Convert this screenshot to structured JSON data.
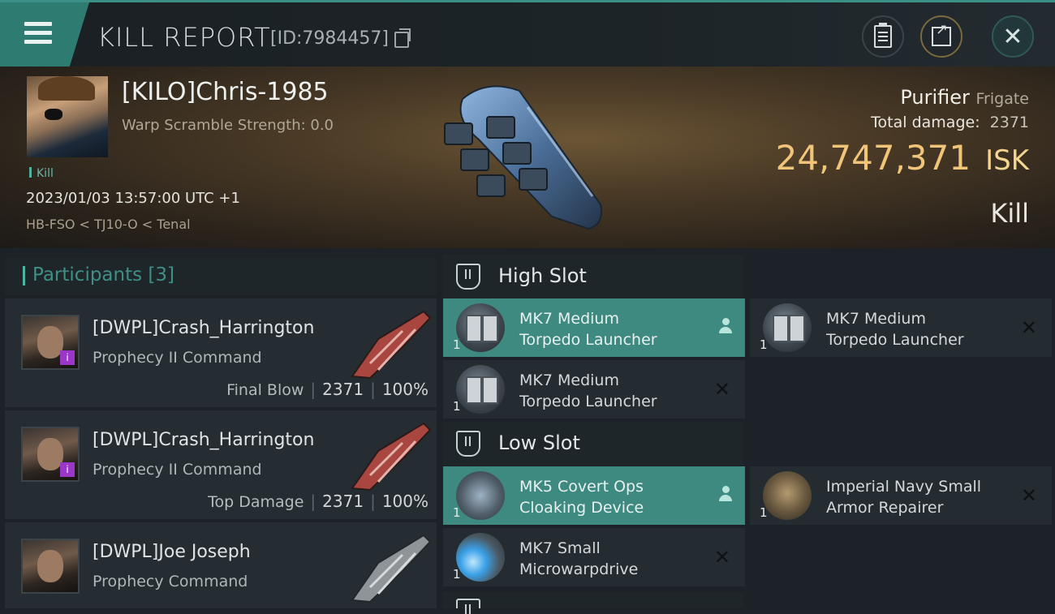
{
  "header": {
    "title": "KILL REPORT",
    "report_id": "[ID:7984457]",
    "icons": [
      "menu-icon",
      "copy-icon",
      "clipboard-icon",
      "external-link-icon",
      "close-icon"
    ]
  },
  "victim": {
    "name": "[KILO]Chris-1985",
    "warp_scramble": "Warp Scramble Strength: 0.0",
    "tag": "Kill",
    "time": "2023/01/03 13:57:00 UTC +1",
    "location": "HB-FSO < TJ10-O < Tenal",
    "ship": "Purifier",
    "ship_class": "Frigate",
    "total_damage_label": "Total damage:",
    "total_damage": "2371",
    "isk_value": "24,747,371",
    "isk_unit": "ISK",
    "result": "Kill"
  },
  "participants": {
    "label": "Participants",
    "count": "[3]",
    "rows": [
      {
        "name": "[DWPL]Crash_Harrington",
        "ship": "Prophecy II Command",
        "role": "Final Blow",
        "damage": "2371",
        "percent": "100%"
      },
      {
        "name": "[DWPL]Crash_Harrington",
        "ship": "Prophecy II Command",
        "role": "Top Damage",
        "damage": "2371",
        "percent": "100%"
      },
      {
        "name": "[DWPL]Joe Joseph",
        "ship": "Prophecy Command"
      }
    ]
  },
  "fitting": {
    "high_slot": {
      "title": "High Slot",
      "modules": [
        {
          "line1": "MK7 Medium",
          "line2": "Torpedo Launcher",
          "qty": "1",
          "status": "person"
        },
        {
          "line1": "MK7 Medium",
          "line2": "Torpedo Launcher",
          "qty": "1",
          "status": "destroyed"
        },
        {
          "line1": "MK7 Medium",
          "line2": "Torpedo Launcher",
          "qty": "1",
          "status": "destroyed"
        }
      ]
    },
    "low_slot": {
      "title": "Low Slot",
      "modules": [
        {
          "line1": "MK5 Covert Ops",
          "line2": "Cloaking Device",
          "qty": "1",
          "status": "person"
        },
        {
          "line1": "Imperial Navy Small",
          "line2": "Armor Repairer",
          "qty": "1",
          "status": "destroyed"
        },
        {
          "line1": "MK7 Small",
          "line2": "Microwarpdrive",
          "qty": "1",
          "status": "destroyed"
        }
      ]
    }
  }
}
